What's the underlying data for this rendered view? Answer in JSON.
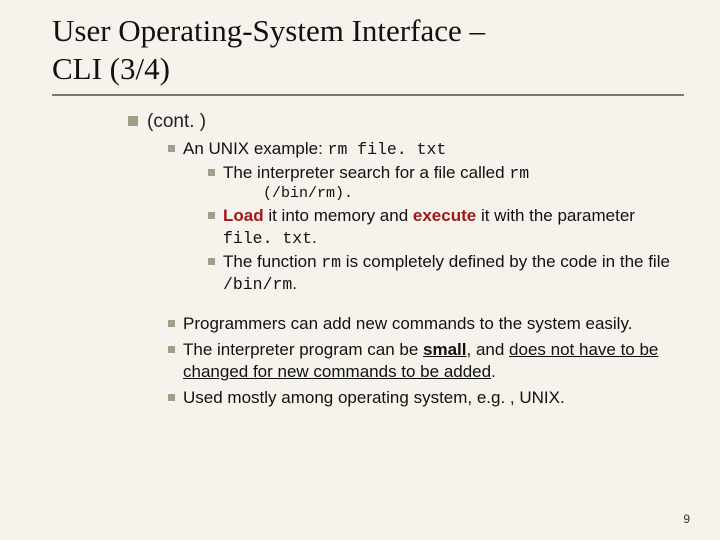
{
  "title_line1": "User Operating-System Interface  –",
  "title_line2": "CLI (3/4)",
  "cont": "(cont. )",
  "l2_example_prefix": "An UNIX example: ",
  "l2_example_code": "rm file. txt",
  "l3_search_prefix": "The interpreter search for a file called ",
  "l3_search_code": "rm",
  "l4_path": "(/bin/rm).",
  "l3_load_1": "Load",
  "l3_load_2": " it into memory and ",
  "l3_load_3": "execute",
  "l3_load_4": " it with the parameter ",
  "l3_load_code": "file. txt",
  "l3_load_5": ".",
  "l3_func_1": "The function ",
  "l3_func_code1": "rm",
  "l3_func_2": " is completely defined by the code in the file ",
  "l3_func_code2": "/bin/rm",
  "l3_func_3": ".",
  "l2_add": "Programmers can add new commands to the system easily.",
  "l2_small_1": "The interpreter program can be ",
  "l2_small_bu": "small",
  "l2_small_2": ", and ",
  "l2_small_u": "does not have to be changed for new commands to be added",
  "l2_small_3": ".",
  "l2_unix": "Used mostly among operating system, e.g. , UNIX.",
  "page": "9"
}
